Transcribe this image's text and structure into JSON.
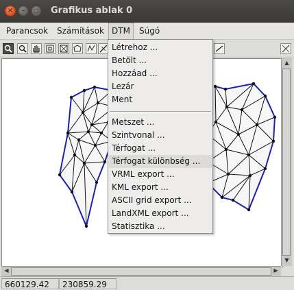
{
  "window": {
    "title": "Grafikus ablak 0"
  },
  "menubar": {
    "items": [
      "Parancsok",
      "Számítások",
      "DTM",
      "Súgó"
    ],
    "open": "DTM"
  },
  "toolbar": {
    "tools": [
      "select-icon",
      "zoom-icon",
      "pan-icon",
      "zoom-window-icon",
      "zoom-all-icon",
      "polygon-icon",
      "triangle-icon",
      "section-icon",
      "line-icon",
      "grid-icon"
    ]
  },
  "dtm_menu": {
    "group1": [
      "Létrehoz ...",
      "Betölt ...",
      "Hozzáad ...",
      "Lezár",
      "Ment"
    ],
    "group2": [
      "Metszet ...",
      "Szintvonal ...",
      "Térfogat ...",
      "Térfogat különbség ...",
      "VRML export ...",
      "KML export ...",
      "ASCII grid export ...",
      "LandXML export ...",
      "Statisztika ..."
    ],
    "highlighted": "Térfogat különbség ..."
  },
  "status": {
    "x": "660129.42",
    "y": "230859.29"
  },
  "colors": {
    "boundary": "#1c22a8",
    "mesh": "#111111",
    "title_bar": "#3c3b37",
    "close_button": "#e4592a"
  }
}
